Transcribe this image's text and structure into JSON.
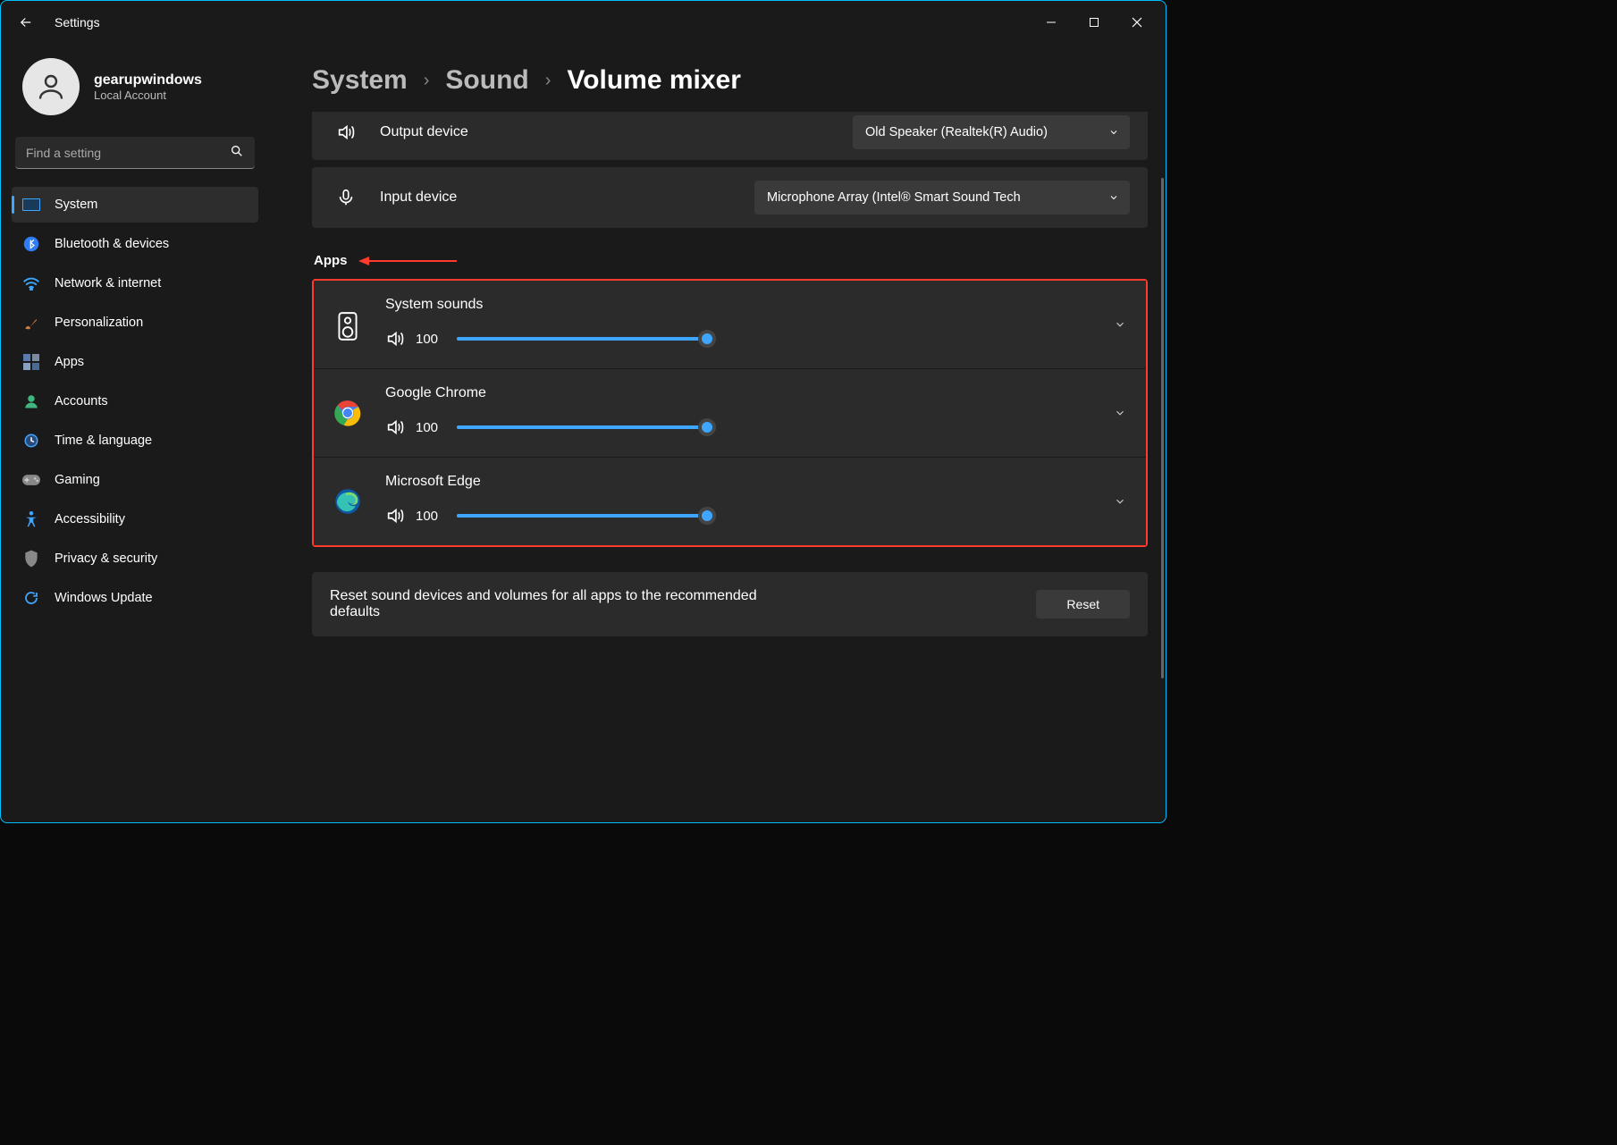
{
  "window": {
    "title": "Settings"
  },
  "user": {
    "name": "gearupwindows",
    "sub": "Local Account"
  },
  "search": {
    "placeholder": "Find a setting"
  },
  "nav": [
    {
      "label": "System",
      "icon": "system",
      "active": true
    },
    {
      "label": "Bluetooth & devices",
      "icon": "bluetooth"
    },
    {
      "label": "Network & internet",
      "icon": "wifi"
    },
    {
      "label": "Personalization",
      "icon": "brush"
    },
    {
      "label": "Apps",
      "icon": "apps"
    },
    {
      "label": "Accounts",
      "icon": "account"
    },
    {
      "label": "Time & language",
      "icon": "clock"
    },
    {
      "label": "Gaming",
      "icon": "game"
    },
    {
      "label": "Accessibility",
      "icon": "access"
    },
    {
      "label": "Privacy & security",
      "icon": "shield"
    },
    {
      "label": "Windows Update",
      "icon": "update"
    }
  ],
  "breadcrumb": {
    "a": "System",
    "b": "Sound",
    "c": "Volume mixer"
  },
  "devices": {
    "output": {
      "label": "Output device",
      "value": "Old Speaker (Realtek(R) Audio)"
    },
    "input": {
      "label": "Input device",
      "value": "Microphone Array (Intel® Smart Sound Tech"
    }
  },
  "apps_header": "Apps",
  "apps": [
    {
      "name": "System sounds",
      "volume": 100,
      "icon": "speaker-device"
    },
    {
      "name": "Google Chrome",
      "volume": 100,
      "icon": "chrome"
    },
    {
      "name": "Microsoft Edge",
      "volume": 100,
      "icon": "edge"
    }
  ],
  "reset": {
    "text": "Reset sound devices and volumes for all apps to the recommended defaults",
    "button": "Reset"
  }
}
